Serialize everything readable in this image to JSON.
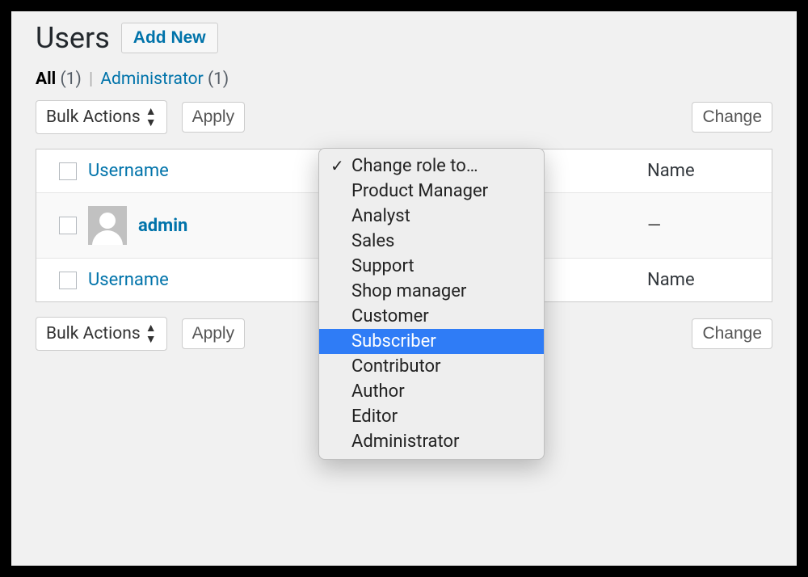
{
  "page": {
    "title": "Users",
    "add_new": "Add New"
  },
  "filters": {
    "all_label": "All",
    "all_count": "(1)",
    "admin_label": "Administrator",
    "admin_count": "(1)"
  },
  "actions_top": {
    "bulk_label": "Bulk Actions",
    "apply": "Apply",
    "change": "Change"
  },
  "actions_bottom": {
    "bulk_label": "Bulk Actions",
    "apply": "Apply",
    "change": "Change"
  },
  "columns": {
    "username": "Username",
    "name": "Name"
  },
  "rows": [
    {
      "username": "admin",
      "name": "—"
    }
  ],
  "role_dropdown": {
    "options": [
      "Change role to…",
      "Product Manager",
      "Analyst",
      "Sales",
      "Support",
      "Shop manager",
      "Customer",
      "Subscriber",
      "Contributor",
      "Author",
      "Editor",
      "Administrator"
    ],
    "checked_index": 0,
    "highlight_index": 7
  }
}
